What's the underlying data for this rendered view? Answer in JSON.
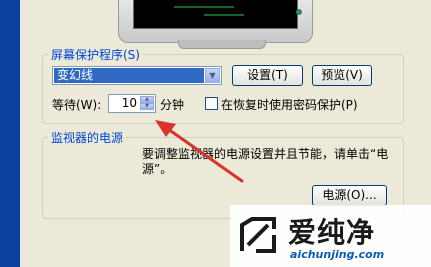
{
  "screensaver": {
    "group_label": "屏幕保护程序(S)",
    "selected": "变幻线",
    "settings_label": "设置(T)",
    "preview_label": "预览(V)",
    "wait_label": "等待(W):",
    "wait_value": "10",
    "minutes_label": "分钟",
    "password_label": "在恢复时使用密码保护(P)",
    "password_checked": false
  },
  "power": {
    "group_label": "监视器的电源",
    "description": "要调整监视器的电源设置并且节能，请单击“电源”。",
    "power_button_label": "电源(O)..."
  },
  "watermark": {
    "title": "爱纯净",
    "url": "aichunjing.com"
  },
  "colors": {
    "annotation_arrow": "#d9332b",
    "group_label": "#0046d5",
    "selection": "#316ac5"
  }
}
